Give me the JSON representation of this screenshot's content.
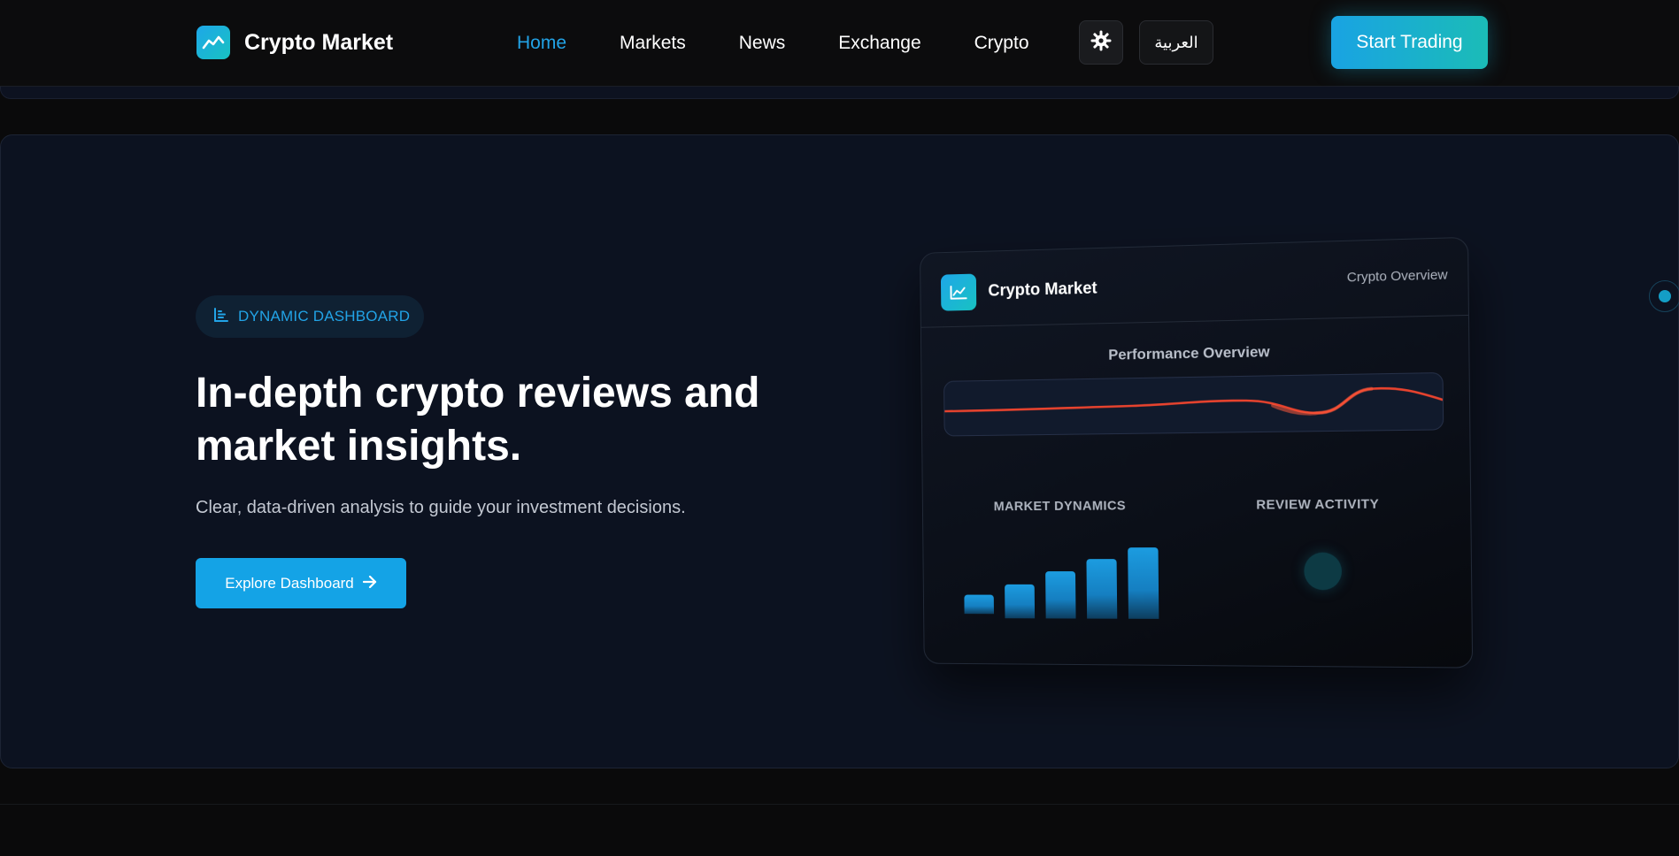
{
  "header": {
    "brand_name": "Crypto Market",
    "nav": [
      {
        "label": "Home",
        "active": true
      },
      {
        "label": "Markets",
        "active": false
      },
      {
        "label": "News",
        "active": false
      },
      {
        "label": "Exchange",
        "active": false
      },
      {
        "label": "Crypto",
        "active": false
      }
    ],
    "theme_icon": "gear-icon",
    "language_label": "العربية",
    "cta_label": "Start Trading"
  },
  "hero": {
    "badge_icon": "bar-chart-icon",
    "badge_label": "DYNAMIC DASHBOARD",
    "title": "In-depth crypto reviews and market insights.",
    "subtitle": "Clear, data-driven analysis to guide your investment decisions.",
    "explore_label": "Explore Dashboard",
    "explore_icon": "arrow-right-icon"
  },
  "dashboard": {
    "brand_name": "Crypto Market",
    "tag": "Crypto Overview",
    "performance_title": "Performance Overview",
    "market_title": "MARKET DYNAMICS",
    "activity_title": "REVIEW ACTIVITY"
  },
  "colors": {
    "accent": "#22a3e6",
    "teal": "#18c2c2",
    "performance_line": "#e8432e",
    "background": "#0a0a0b",
    "hero_bg": "#0c1220"
  }
}
